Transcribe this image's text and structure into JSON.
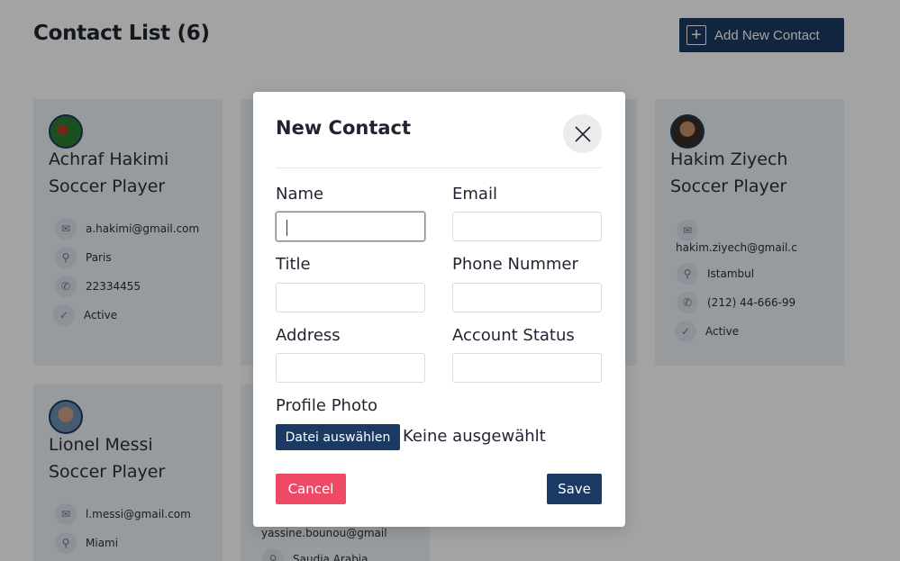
{
  "header": {
    "title": "Contact List (6)",
    "add_button_label": "Add New Contact"
  },
  "contacts": [
    {
      "name": "Achraf Hakimi",
      "title": "Soccer Player",
      "email": "a.hakimi@gmail.com",
      "city": "Paris",
      "phone": "22334455",
      "status": "Active"
    },
    {
      "name": "Hakim Ziyech",
      "title": "Soccer Player",
      "email": "hakim.ziyech@gmail.c",
      "city": "Istambul",
      "phone": "(212) 44-666-99",
      "status": "Active"
    },
    {
      "name": "Lionel Messi",
      "title": "Soccer Player",
      "email": "l.messi@gmail.com",
      "city": "Miami"
    },
    {
      "email": "yassine.bounou@gmail",
      "city": "Saudia Arabia"
    }
  ],
  "modal": {
    "title": "New Contact",
    "fields": {
      "name_label": "Name",
      "email_label": "Email",
      "title_label": "Title",
      "phone_label": "Phone Nummer",
      "address_label": "Address",
      "status_label": "Account Status",
      "photo_label": "Profile Photo"
    },
    "values": {
      "name": "",
      "email": "",
      "title": "",
      "phone": "",
      "address": "",
      "status": ""
    },
    "file_button_label": "Datei auswählen",
    "file_status": "Keine ausgewählt",
    "cancel_label": "Cancel",
    "save_label": "Save"
  },
  "colors": {
    "primary": "#1b3a63",
    "danger": "#ee4a66",
    "card_bg": "#edf3f8"
  }
}
